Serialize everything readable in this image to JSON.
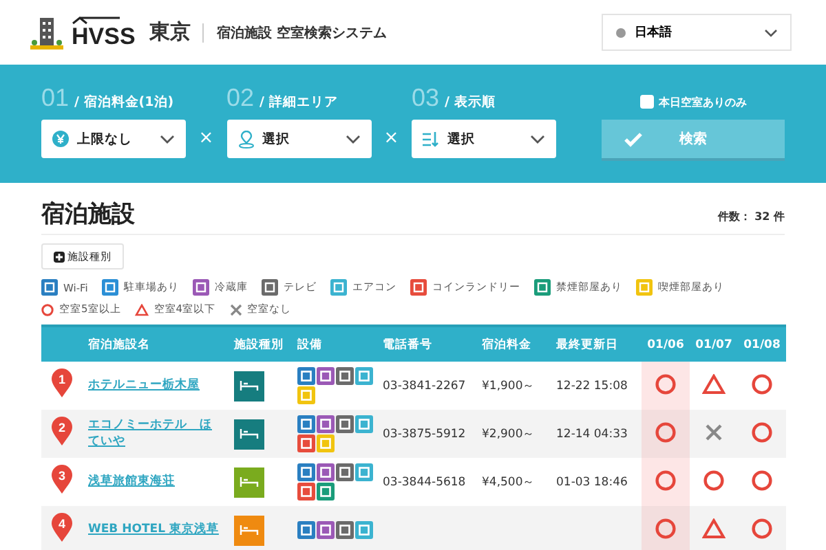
{
  "header": {
    "logo_text": "HVSS",
    "city": "東京",
    "system_title": "宿泊施設 空室検索システム",
    "language": "日本語"
  },
  "search": {
    "steps": [
      {
        "number": "01",
        "label": "/ 宿泊料金(1泊)",
        "value": "上限なし"
      },
      {
        "number": "02",
        "label": "/ 詳細エリア",
        "value": "選択"
      },
      {
        "number": "03",
        "label": "/ 表示順",
        "value": "選択"
      }
    ],
    "separator": "×",
    "vacancy_only": {
      "label": "本日空室ありのみ",
      "checked": false
    },
    "search_button": "検索"
  },
  "section": {
    "title": "宿泊施設",
    "count": "件数： 32 件",
    "filter_button": "施設種別"
  },
  "amenity_legend": [
    {
      "kind": "wifi",
      "label": "Wi-Fi"
    },
    {
      "kind": "parking",
      "label": "駐車場あり"
    },
    {
      "kind": "fridge",
      "label": "冷蔵庫"
    },
    {
      "kind": "tv",
      "label": "テレビ"
    },
    {
      "kind": "aircon",
      "label": "エアコン"
    },
    {
      "kind": "laundry",
      "label": "コインランドリー"
    },
    {
      "kind": "nonsmoking",
      "label": "禁煙部屋あり"
    },
    {
      "kind": "smoking",
      "label": "喫煙部屋あり"
    }
  ],
  "availability_legend": [
    {
      "kind": "circle",
      "label": "空室5室以上"
    },
    {
      "kind": "triangle",
      "label": "空室4室以下"
    },
    {
      "kind": "cross",
      "label": "空室なし"
    }
  ],
  "table": {
    "columns": [
      "宿泊施設名",
      "施設種別",
      "設備",
      "電話番号",
      "宿泊料金",
      "最終更新日"
    ],
    "dates": [
      {
        "label": "01/06",
        "selected": true
      },
      {
        "label": "01/07",
        "selected": false
      },
      {
        "label": "01/08",
        "selected": false
      }
    ],
    "rows": [
      {
        "pin": "1",
        "name": "ホテルニュー栃木屋",
        "type": {
          "kind": "business"
        },
        "amenities": [
          {
            "kind": "wifi"
          },
          {
            "kind": "fridge"
          },
          {
            "kind": "tv"
          },
          {
            "kind": "aircon"
          },
          {
            "kind": "smoking"
          }
        ],
        "phone": "03-3841-2267",
        "price": "¥1,900～",
        "updated": "12-22 15:08",
        "availability": [
          {
            "kind": "circle"
          },
          {
            "kind": "triangle"
          },
          {
            "kind": "circle"
          }
        ]
      },
      {
        "pin": "2",
        "name": "エコノミーホテル　ほていや",
        "type": {
          "kind": "business"
        },
        "amenities": [
          {
            "kind": "wifi"
          },
          {
            "kind": "fridge"
          },
          {
            "kind": "tv"
          },
          {
            "kind": "aircon"
          },
          {
            "kind": "laundry"
          },
          {
            "kind": "smoking"
          }
        ],
        "phone": "03-3875-5912",
        "price": "¥2,900～",
        "updated": "12-14 04:33",
        "availability": [
          {
            "kind": "circle"
          },
          {
            "kind": "cross"
          },
          {
            "kind": "circle"
          }
        ]
      },
      {
        "pin": "3",
        "name": "浅草旅館東海荘",
        "type": {
          "kind": "ryokan"
        },
        "amenities": [
          {
            "kind": "wifi"
          },
          {
            "kind": "fridge"
          },
          {
            "kind": "tv"
          },
          {
            "kind": "aircon"
          },
          {
            "kind": "laundry"
          },
          {
            "kind": "nonsmoking"
          }
        ],
        "phone": "03-3844-5618",
        "price": "¥4,500～",
        "updated": "01-03 18:46",
        "availability": [
          {
            "kind": "circle"
          },
          {
            "kind": "circle"
          },
          {
            "kind": "circle"
          }
        ]
      },
      {
        "pin": "4",
        "name": "WEB HOTEL 東京浅草",
        "type": {
          "kind": "hotel"
        },
        "amenities": [
          {
            "kind": "wifi"
          },
          {
            "kind": "fridge"
          },
          {
            "kind": "tv"
          },
          {
            "kind": "aircon"
          }
        ],
        "availability": [
          {
            "kind": "circle"
          },
          {
            "kind": "triangle"
          },
          {
            "kind": "circle"
          }
        ]
      }
    ]
  }
}
